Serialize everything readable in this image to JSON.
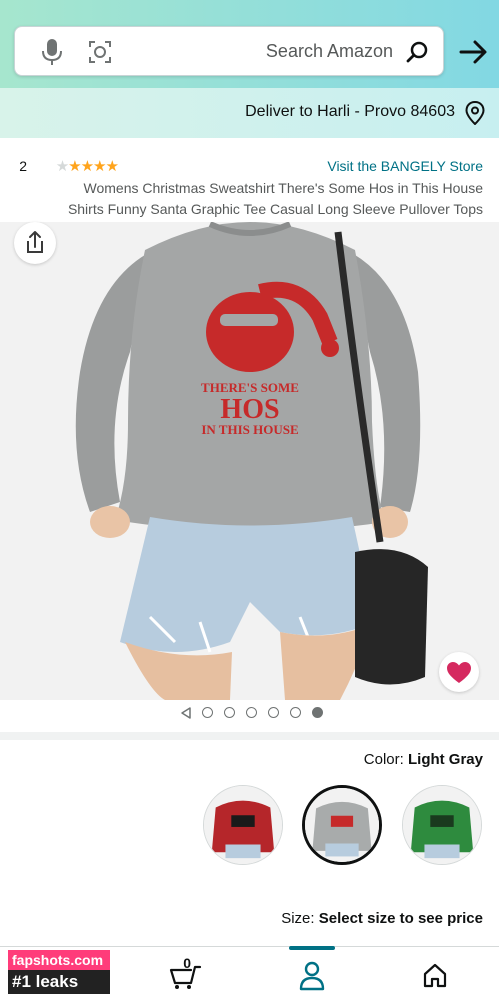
{
  "search": {
    "placeholder": "Search Amazon"
  },
  "delivery": {
    "text": "Deliver to Harli - Provo 84603"
  },
  "product": {
    "store_link": "Visit the BANGELY Store",
    "rating_stars": 4,
    "rating_count": "2",
    "title_line1": "Womens Christmas Sweatshirt There's Some Hos in This House",
    "title_line2": "Shirts Funny Santa Graphic Tee Casual Long Sleeve Pullover Tops",
    "print_line1": "THERE'S SOME",
    "print_line2": "HOS",
    "print_line3": "IN THIS HOUSE"
  },
  "gallery": {
    "image_count": 6,
    "active_index": 0,
    "has_video": true
  },
  "color": {
    "label": "Color:",
    "value": "Light Gray"
  },
  "swatches": [
    {
      "name": "Green",
      "hex": "#2e8b3e"
    },
    {
      "name": "Light Gray",
      "hex": "#a8abab",
      "selected": true
    },
    {
      "name": "Red",
      "hex": "#b5262a"
    }
  ],
  "size": {
    "label": "Size:",
    "value": "Select size to see price"
  },
  "nav": {
    "cart_count": "0"
  },
  "watermark": {
    "line1": "fapshots.com",
    "line2": "#1 leaks"
  },
  "colors": {
    "header_start": "#82d8e3",
    "header_end": "#a6e6ce",
    "link": "#007185",
    "star": "#ffa41c",
    "heart": "#d5295f"
  }
}
